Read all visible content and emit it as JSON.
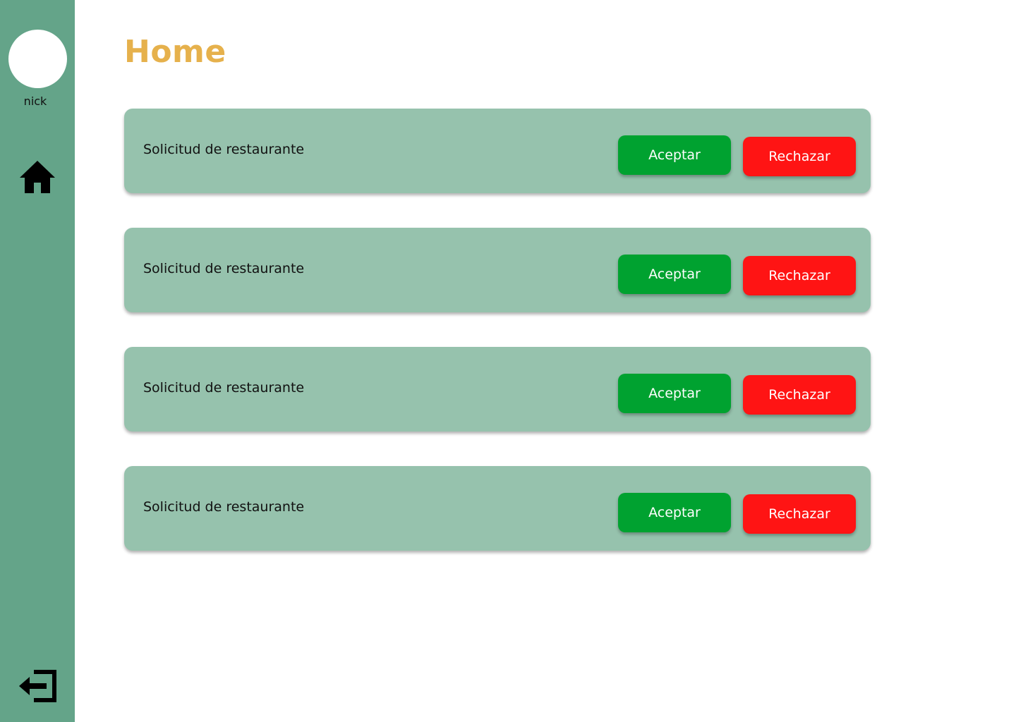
{
  "sidebar": {
    "username": "nick",
    "nav": [
      {
        "icon": "home-icon"
      },
      {
        "icon": "logout-icon"
      }
    ]
  },
  "page": {
    "title": "Home"
  },
  "requests": [
    {
      "label": "Solicitud de restaurante",
      "accept_label": "Aceptar",
      "reject_label": "Rechazar"
    },
    {
      "label": "Solicitud de restaurante",
      "accept_label": "Aceptar",
      "reject_label": "Rechazar"
    },
    {
      "label": "Solicitud de restaurante",
      "accept_label": "Aceptar",
      "reject_label": "Rechazar"
    },
    {
      "label": "Solicitud de restaurante",
      "accept_label": "Aceptar",
      "reject_label": "Rechazar"
    }
  ],
  "colors": {
    "sidebar": "#64a489",
    "card": "#96c2ad",
    "title": "#e6b14c",
    "accept": "#00a230",
    "reject": "#ff1414"
  }
}
